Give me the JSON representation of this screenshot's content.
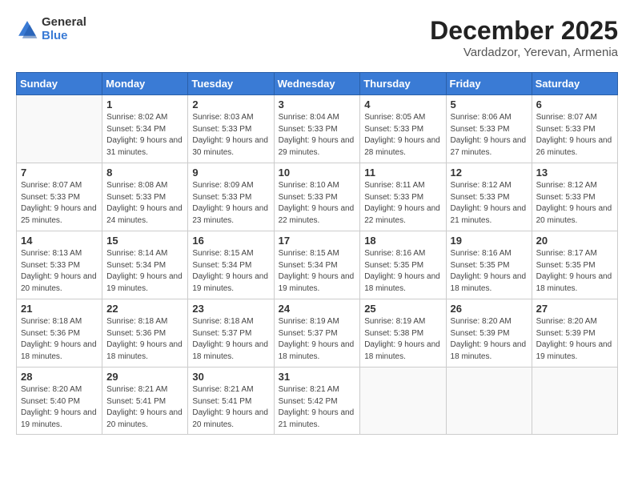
{
  "header": {
    "logo_line1": "General",
    "logo_line2": "Blue",
    "month_title": "December 2025",
    "subtitle": "Vardadzor, Yerevan, Armenia"
  },
  "weekdays": [
    "Sunday",
    "Monday",
    "Tuesday",
    "Wednesday",
    "Thursday",
    "Friday",
    "Saturday"
  ],
  "weeks": [
    [
      {
        "day": "",
        "sunrise": "",
        "sunset": "",
        "daylight": ""
      },
      {
        "day": "1",
        "sunrise": "8:02 AM",
        "sunset": "5:34 PM",
        "daylight": "9 hours and 31 minutes."
      },
      {
        "day": "2",
        "sunrise": "8:03 AM",
        "sunset": "5:33 PM",
        "daylight": "9 hours and 30 minutes."
      },
      {
        "day": "3",
        "sunrise": "8:04 AM",
        "sunset": "5:33 PM",
        "daylight": "9 hours and 29 minutes."
      },
      {
        "day": "4",
        "sunrise": "8:05 AM",
        "sunset": "5:33 PM",
        "daylight": "9 hours and 28 minutes."
      },
      {
        "day": "5",
        "sunrise": "8:06 AM",
        "sunset": "5:33 PM",
        "daylight": "9 hours and 27 minutes."
      },
      {
        "day": "6",
        "sunrise": "8:07 AM",
        "sunset": "5:33 PM",
        "daylight": "9 hours and 26 minutes."
      }
    ],
    [
      {
        "day": "7",
        "sunrise": "8:07 AM",
        "sunset": "5:33 PM",
        "daylight": "9 hours and 25 minutes."
      },
      {
        "day": "8",
        "sunrise": "8:08 AM",
        "sunset": "5:33 PM",
        "daylight": "9 hours and 24 minutes."
      },
      {
        "day": "9",
        "sunrise": "8:09 AM",
        "sunset": "5:33 PM",
        "daylight": "9 hours and 23 minutes."
      },
      {
        "day": "10",
        "sunrise": "8:10 AM",
        "sunset": "5:33 PM",
        "daylight": "9 hours and 22 minutes."
      },
      {
        "day": "11",
        "sunrise": "8:11 AM",
        "sunset": "5:33 PM",
        "daylight": "9 hours and 22 minutes."
      },
      {
        "day": "12",
        "sunrise": "8:12 AM",
        "sunset": "5:33 PM",
        "daylight": "9 hours and 21 minutes."
      },
      {
        "day": "13",
        "sunrise": "8:12 AM",
        "sunset": "5:33 PM",
        "daylight": "9 hours and 20 minutes."
      }
    ],
    [
      {
        "day": "14",
        "sunrise": "8:13 AM",
        "sunset": "5:33 PM",
        "daylight": "9 hours and 20 minutes."
      },
      {
        "day": "15",
        "sunrise": "8:14 AM",
        "sunset": "5:34 PM",
        "daylight": "9 hours and 19 minutes."
      },
      {
        "day": "16",
        "sunrise": "8:15 AM",
        "sunset": "5:34 PM",
        "daylight": "9 hours and 19 minutes."
      },
      {
        "day": "17",
        "sunrise": "8:15 AM",
        "sunset": "5:34 PM",
        "daylight": "9 hours and 19 minutes."
      },
      {
        "day": "18",
        "sunrise": "8:16 AM",
        "sunset": "5:35 PM",
        "daylight": "9 hours and 18 minutes."
      },
      {
        "day": "19",
        "sunrise": "8:16 AM",
        "sunset": "5:35 PM",
        "daylight": "9 hours and 18 minutes."
      },
      {
        "day": "20",
        "sunrise": "8:17 AM",
        "sunset": "5:35 PM",
        "daylight": "9 hours and 18 minutes."
      }
    ],
    [
      {
        "day": "21",
        "sunrise": "8:18 AM",
        "sunset": "5:36 PM",
        "daylight": "9 hours and 18 minutes."
      },
      {
        "day": "22",
        "sunrise": "8:18 AM",
        "sunset": "5:36 PM",
        "daylight": "9 hours and 18 minutes."
      },
      {
        "day": "23",
        "sunrise": "8:18 AM",
        "sunset": "5:37 PM",
        "daylight": "9 hours and 18 minutes."
      },
      {
        "day": "24",
        "sunrise": "8:19 AM",
        "sunset": "5:37 PM",
        "daylight": "9 hours and 18 minutes."
      },
      {
        "day": "25",
        "sunrise": "8:19 AM",
        "sunset": "5:38 PM",
        "daylight": "9 hours and 18 minutes."
      },
      {
        "day": "26",
        "sunrise": "8:20 AM",
        "sunset": "5:39 PM",
        "daylight": "9 hours and 18 minutes."
      },
      {
        "day": "27",
        "sunrise": "8:20 AM",
        "sunset": "5:39 PM",
        "daylight": "9 hours and 19 minutes."
      }
    ],
    [
      {
        "day": "28",
        "sunrise": "8:20 AM",
        "sunset": "5:40 PM",
        "daylight": "9 hours and 19 minutes."
      },
      {
        "day": "29",
        "sunrise": "8:21 AM",
        "sunset": "5:41 PM",
        "daylight": "9 hours and 20 minutes."
      },
      {
        "day": "30",
        "sunrise": "8:21 AM",
        "sunset": "5:41 PM",
        "daylight": "9 hours and 20 minutes."
      },
      {
        "day": "31",
        "sunrise": "8:21 AM",
        "sunset": "5:42 PM",
        "daylight": "9 hours and 21 minutes."
      },
      {
        "day": "",
        "sunrise": "",
        "sunset": "",
        "daylight": ""
      },
      {
        "day": "",
        "sunrise": "",
        "sunset": "",
        "daylight": ""
      },
      {
        "day": "",
        "sunrise": "",
        "sunset": "",
        "daylight": ""
      }
    ]
  ]
}
